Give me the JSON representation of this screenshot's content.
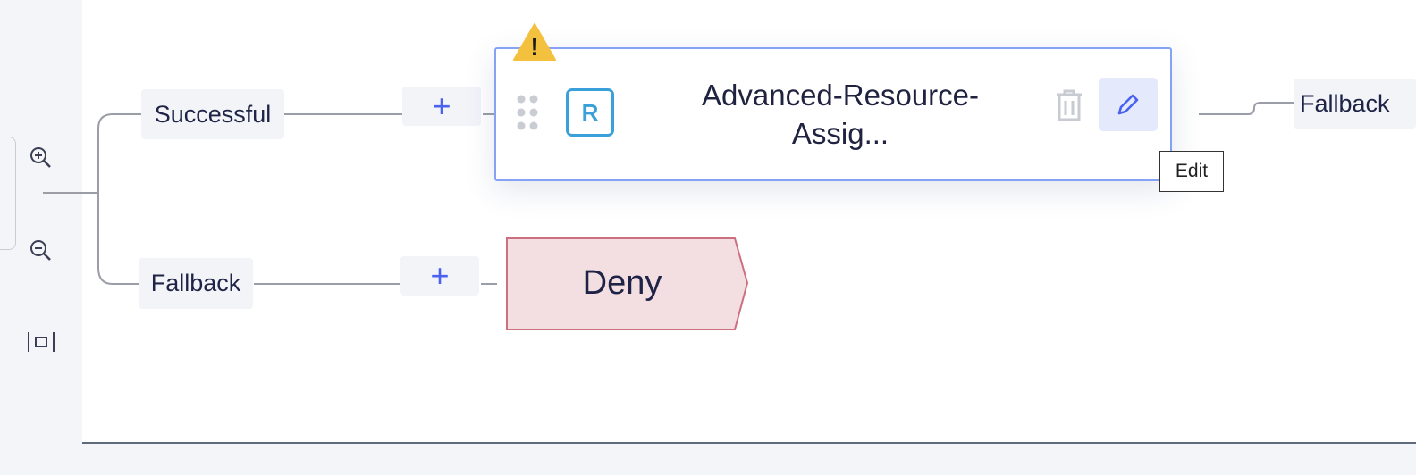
{
  "toolbar": {
    "zoom_in_icon": "zoom-in-icon",
    "zoom_out_icon": "zoom-out-icon",
    "fit_icon": "fit-to-screen-icon"
  },
  "branches": {
    "successful_label": "Successful",
    "fallback_label": "Fallback",
    "right_fallback_label": "Fallback",
    "add_symbol": "+"
  },
  "node": {
    "badge": "R",
    "title_line1": "Advanced-Resource-",
    "title_line2": "Assig...",
    "warning_symbol": "!",
    "edit_tooltip": "Edit"
  },
  "deny": {
    "label": "Deny"
  },
  "colors": {
    "accent": "#4b62f0",
    "node_border": "#86a2f5",
    "badge": "#3aa0d9",
    "warning": "#f4c13e",
    "deny_fill": "#f3dfe2",
    "deny_border": "#cc6f7f"
  }
}
